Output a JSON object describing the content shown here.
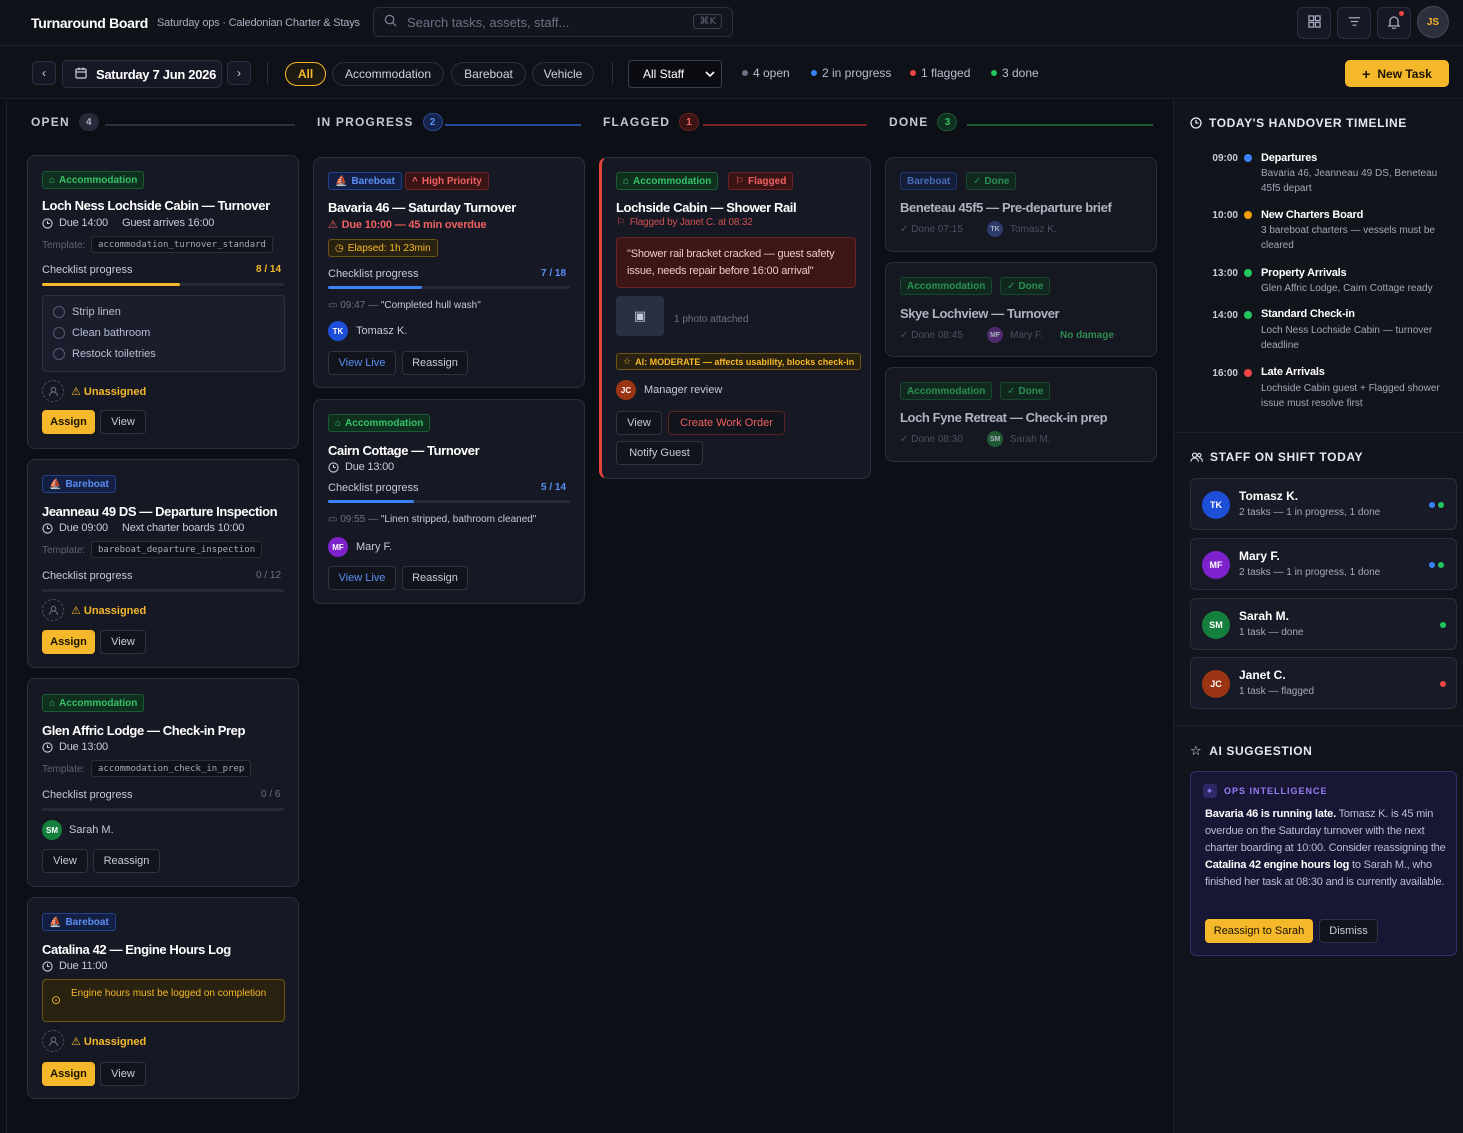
{
  "header": {
    "title": "Turnaround Board",
    "subtitle": "Saturday ops · Caledonian Charter & Stays",
    "search_placeholder": "Search tasks, assets, staff...",
    "shortcut": "⌘K",
    "user_initials": "JS"
  },
  "toolbar": {
    "date": "Saturday 7 Jun 2026",
    "filters": [
      "All",
      "Accommodation",
      "Bareboat",
      "Vehicle"
    ],
    "active_filter": "All",
    "staff_select": "All Staff",
    "stats": {
      "open": "4 open",
      "in_progress": "2 in progress",
      "flagged": "1 flagged",
      "done": "3 done"
    },
    "new_task": "New Task"
  },
  "columns": {
    "open": {
      "title": "OPEN",
      "count": "4"
    },
    "in_progress": {
      "title": "IN PROGRESS",
      "count": "2"
    },
    "flagged": {
      "title": "FLAGGED",
      "count": "1"
    },
    "done": {
      "title": "DONE",
      "count": "3"
    }
  },
  "open_cards": [
    {
      "tag": "Accommodation",
      "title": "Loch Ness Lochside Cabin — Turnover",
      "due": "Due 14:00",
      "extra": "Guest arrives 16:00",
      "template_label": "Template:",
      "template": "accommodation_turnover_standard",
      "progress_label": "Checklist progress",
      "progress_text": "8 / 14",
      "progress": 0.571,
      "checklist": [
        "Strip linen",
        "Clean bathroom",
        "Restock toiletries"
      ],
      "assignee": "Unassigned",
      "btn1": "Assign",
      "btn2": "View"
    },
    {
      "tag": "Bareboat",
      "title": "Jeanneau 49 DS — Departure Inspection",
      "due": "Due 09:00",
      "extra": "Next charter boards 10:00",
      "template_label": "Template:",
      "template": "bareboat_departure_inspection",
      "progress_label": "Checklist progress",
      "progress_text": "0 / 12",
      "progress": 0,
      "assignee": "Unassigned",
      "btn1": "Assign",
      "btn2": "View"
    },
    {
      "tag": "Accommodation",
      "title": "Glen Affric Lodge — Check-in Prep",
      "due": "Due 13:00",
      "template_label": "Template:",
      "template": "accommodation_check_in_prep",
      "progress_label": "Checklist progress",
      "progress_text": "0 / 6",
      "progress": 0,
      "assignee_initials": "SM",
      "assignee": "Sarah M.",
      "btn1": "View",
      "btn2": "Reassign"
    },
    {
      "tag": "Bareboat",
      "title": "Catalina 42 — Engine Hours Log",
      "due": "Due 11:00",
      "warning": "Engine hours must be logged on completion",
      "assignee": "Unassigned",
      "btn1": "Assign",
      "btn2": "View"
    }
  ],
  "progress_cards": [
    {
      "tag": "Bareboat",
      "tag2": "High Priority",
      "title": "Bavaria 46 — Saturday Turnover",
      "due": "Due 10:00 — 45 min overdue",
      "elapsed": "Elapsed: 1h 23min",
      "progress_label": "Checklist progress",
      "progress_text": "7 / 18",
      "progress": 0.389,
      "note_time": "09:47 —",
      "note": "\"Completed hull wash\"",
      "assignee_initials": "TK",
      "assignee": "Tomasz K.",
      "btn1": "View Live",
      "btn2": "Reassign"
    },
    {
      "tag": "Accommodation",
      "title": "Cairn Cottage — Turnover",
      "due": "Due 13:00",
      "progress_label": "Checklist progress",
      "progress_text": "5 / 14",
      "progress": 0.357,
      "note_time": "09:55 —",
      "note": "\"Linen stripped, bathroom cleaned\"",
      "assignee_initials": "MF",
      "assignee": "Mary F.",
      "btn1": "View Live",
      "btn2": "Reassign"
    }
  ],
  "flagged_card": {
    "tag": "Accommodation",
    "tag2": "Flagged",
    "title": "Lochside Cabin — Shower Rail",
    "flagged_by": "Flagged by Janet C. at 08:32",
    "quote": "\"Shower rail bracket cracked — guest safety issue, needs repair before 16:00 arrival\"",
    "photo": "1 photo attached",
    "ai_badge": "AI: MODERATE — affects usability, blocks check-in",
    "reviewer_initials": "JC",
    "reviewer": "Manager review",
    "btn1": "View",
    "btn2": "Create Work Order",
    "btn3": "Notify Guest"
  },
  "done_cards": [
    {
      "tag": "Bareboat",
      "tag2": "Done",
      "title": "Beneteau 45f5 — Pre-departure brief",
      "done": "Done 07:15",
      "initials": "TK",
      "name": "Tomasz K."
    },
    {
      "tag": "Accommodation",
      "tag2": "Done",
      "title": "Skye Lochview — Turnover",
      "done": "Done 08:45",
      "initials": "MF",
      "name": "Mary F.",
      "extra": "No damage"
    },
    {
      "tag": "Accommodation",
      "tag2": "Done",
      "title": "Loch Fyne Retreat — Check-in prep",
      "done": "Done 08:30",
      "initials": "SM",
      "name": "Sarah M."
    }
  ],
  "timeline": {
    "title": "TODAY'S HANDOVER TIMELINE",
    "items": [
      {
        "time": "09:00",
        "title": "Departures",
        "desc": "Bavaria 46, Jeanneau 49 DS, Beneteau 45f5 depart",
        "color": "#3b82f6"
      },
      {
        "time": "10:00",
        "title": "New Charters Board",
        "desc": "3 bareboat charters — vessels must be cleared",
        "color": "#f59e0b"
      },
      {
        "time": "13:00",
        "title": "Property Arrivals",
        "desc": "Glen Affric Lodge, Cairn Cottage ready",
        "color": "#22c55e"
      },
      {
        "time": "14:00",
        "title": "Standard Check-in",
        "desc": "Loch Ness Lochside Cabin — turnover deadline",
        "color": "#22c55e"
      },
      {
        "time": "16:00",
        "title": "Late Arrivals",
        "desc": "Lochside Cabin guest + Flagged shower issue must resolve first",
        "color": "#ef4444"
      }
    ]
  },
  "staff": {
    "title": "STAFF ON SHIFT TODAY",
    "members": [
      {
        "initials": "TK",
        "name": "Tomasz K.",
        "sub": "2 tasks — 1 in progress, 1 done"
      },
      {
        "initials": "MF",
        "name": "Mary F.",
        "sub": "2 tasks — 1 in progress, 1 done"
      },
      {
        "initials": "SM",
        "name": "Sarah M.",
        "sub": "1 task — done"
      },
      {
        "initials": "JC",
        "name": "Janet C.",
        "sub": "1 task — flagged"
      }
    ]
  },
  "ai": {
    "title": "AI SUGGESTION",
    "tag": "OPS INTELLIGENCE",
    "lead": "Bavaria 46 is running late.",
    "text1": " Tomasz K. is 45 min overdue on the Saturday turnover with the next charter boarding at 10:00. Consider reassigning the ",
    "bold2": "Catalina 42 engine hours log",
    "text2": " to Sarah M., who finished her task at 08:30 and is currently available.",
    "accept": "Reassign to Sarah",
    "dismiss": "Dismiss"
  },
  "colors": {
    "accent": "#f5b82a",
    "open": "#c3c8d6",
    "in_progress": "#3b82f6",
    "flagged": "#ef4444",
    "done": "#22c55e"
  }
}
